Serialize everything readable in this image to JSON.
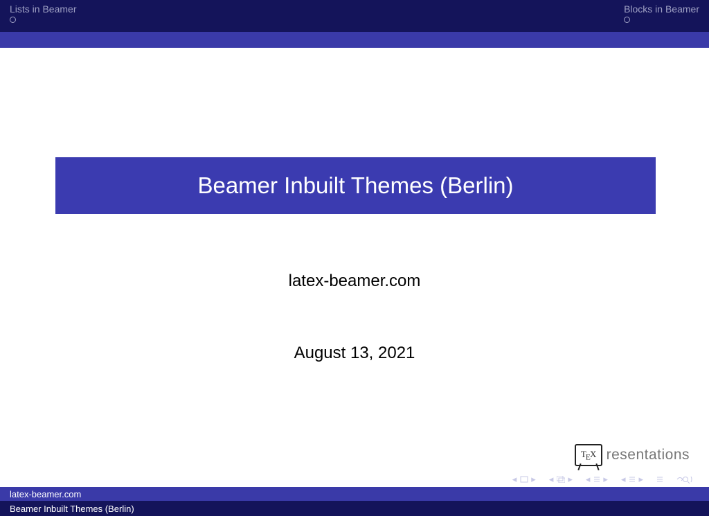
{
  "headline": {
    "left_section": "Lists in Beamer",
    "right_section": "Blocks in Beamer"
  },
  "title": "Beamer Inbuilt Themes (Berlin)",
  "author": "latex-beamer.com",
  "date": "August 13, 2021",
  "logo": {
    "tex": "TEX",
    "word": "resentations"
  },
  "footer": {
    "line1": "latex-beamer.com",
    "line2": "Beamer Inbuilt Themes (Berlin)"
  },
  "colors": {
    "dark": "#14145a",
    "mid": "#3b3bb0",
    "nav": "#c7c8e6"
  }
}
